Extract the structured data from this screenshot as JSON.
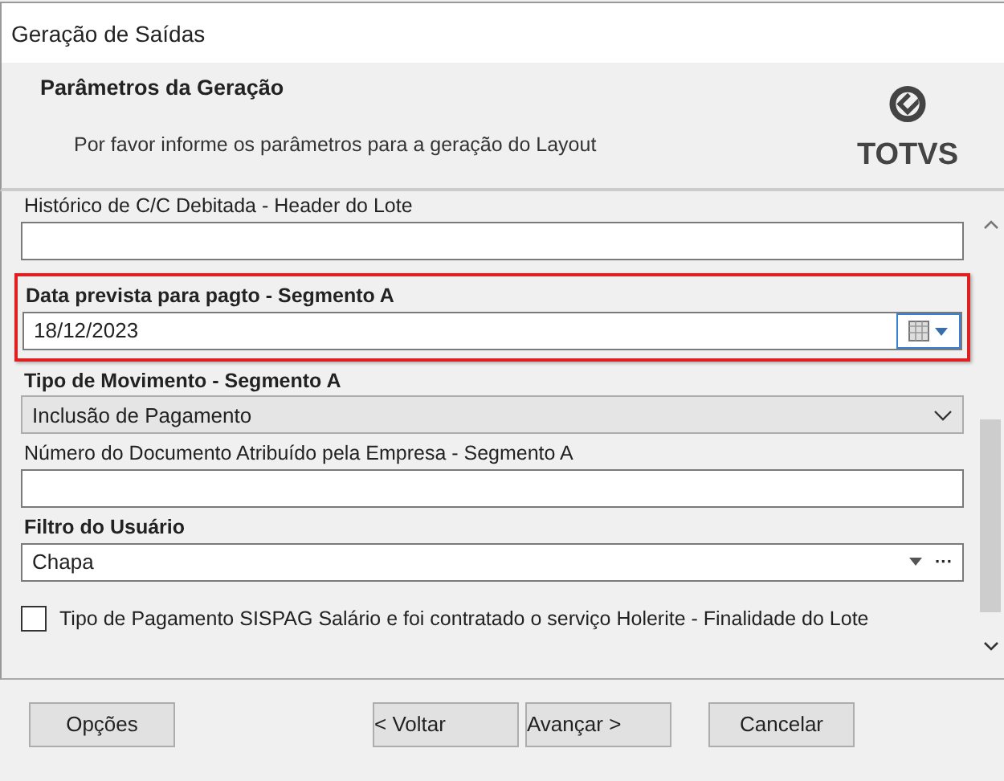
{
  "window": {
    "title": "Geração de Saídas"
  },
  "header": {
    "title": "Parâmetros da Geração",
    "subtitle": "Por favor informe os parâmetros para a geração do Layout",
    "logo": "TOTVS"
  },
  "fields": [
    {
      "kind": "text",
      "label": "Histórico de C/C Debitada - Header do Lote",
      "required": false,
      "highlighted": false
    },
    {
      "kind": "date",
      "label": "Data prevista para pagto - Segmento A",
      "required": true,
      "highlighted": true,
      "value": "18/12/2023"
    },
    {
      "kind": "select",
      "label": "Tipo de Movimento - Segmento A",
      "required": true,
      "highlighted": false,
      "value": "Inclusão de Pagamento"
    },
    {
      "kind": "text",
      "label": "Número do Documento Atribuído pela Empresa - Segmento A",
      "required": false,
      "highlighted": false
    },
    {
      "kind": "lookup",
      "label": "Filtro do Usuário",
      "required": true,
      "highlighted": false,
      "value": "Chapa",
      "more": "···"
    },
    {
      "kind": "checkbox",
      "label": "Tipo de Pagamento SISPAG Salário e foi contratado o serviço Holerite - Finalidade do Lote",
      "checked": false
    }
  ],
  "buttons": [
    {
      "label": "Opções",
      "kind": "options"
    },
    {
      "label": "< Voltar",
      "kind": "nav"
    },
    {
      "label": "Avançar >",
      "kind": "nav"
    },
    {
      "label": "Cancelar",
      "kind": "cancel"
    }
  ]
}
